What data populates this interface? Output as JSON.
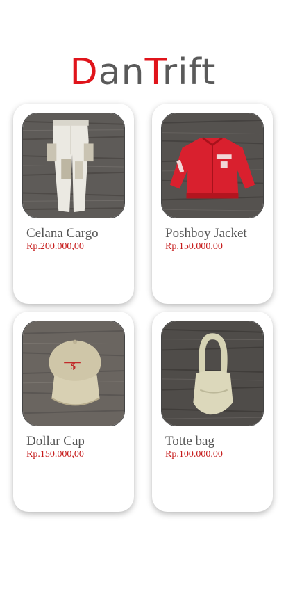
{
  "brand": {
    "letters": [
      {
        "char": "D",
        "accent": true
      },
      {
        "char": "a",
        "accent": false
      },
      {
        "char": "n",
        "accent": false
      },
      {
        "char": "T",
        "accent": true
      },
      {
        "char": "r",
        "accent": false
      },
      {
        "char": "i",
        "accent": false
      },
      {
        "char": "f",
        "accent": false
      },
      {
        "char": "t",
        "accent": false
      }
    ],
    "accent_color": "#e0141b",
    "base_color": "#5a5a5a"
  },
  "products": [
    {
      "name": "Celana Cargo",
      "price": "Rp.200.000,00",
      "icon": "cargo-pants-photo"
    },
    {
      "name": "Poshboy Jacket",
      "price": "Rp.150.000,00",
      "icon": "red-jacket-photo"
    },
    {
      "name": "Dollar Cap",
      "price": "Rp.150.000,00",
      "icon": "cap-photo"
    },
    {
      "name": "Totte bag",
      "price": "Rp.100.000,00",
      "icon": "tote-bag-photo"
    }
  ]
}
